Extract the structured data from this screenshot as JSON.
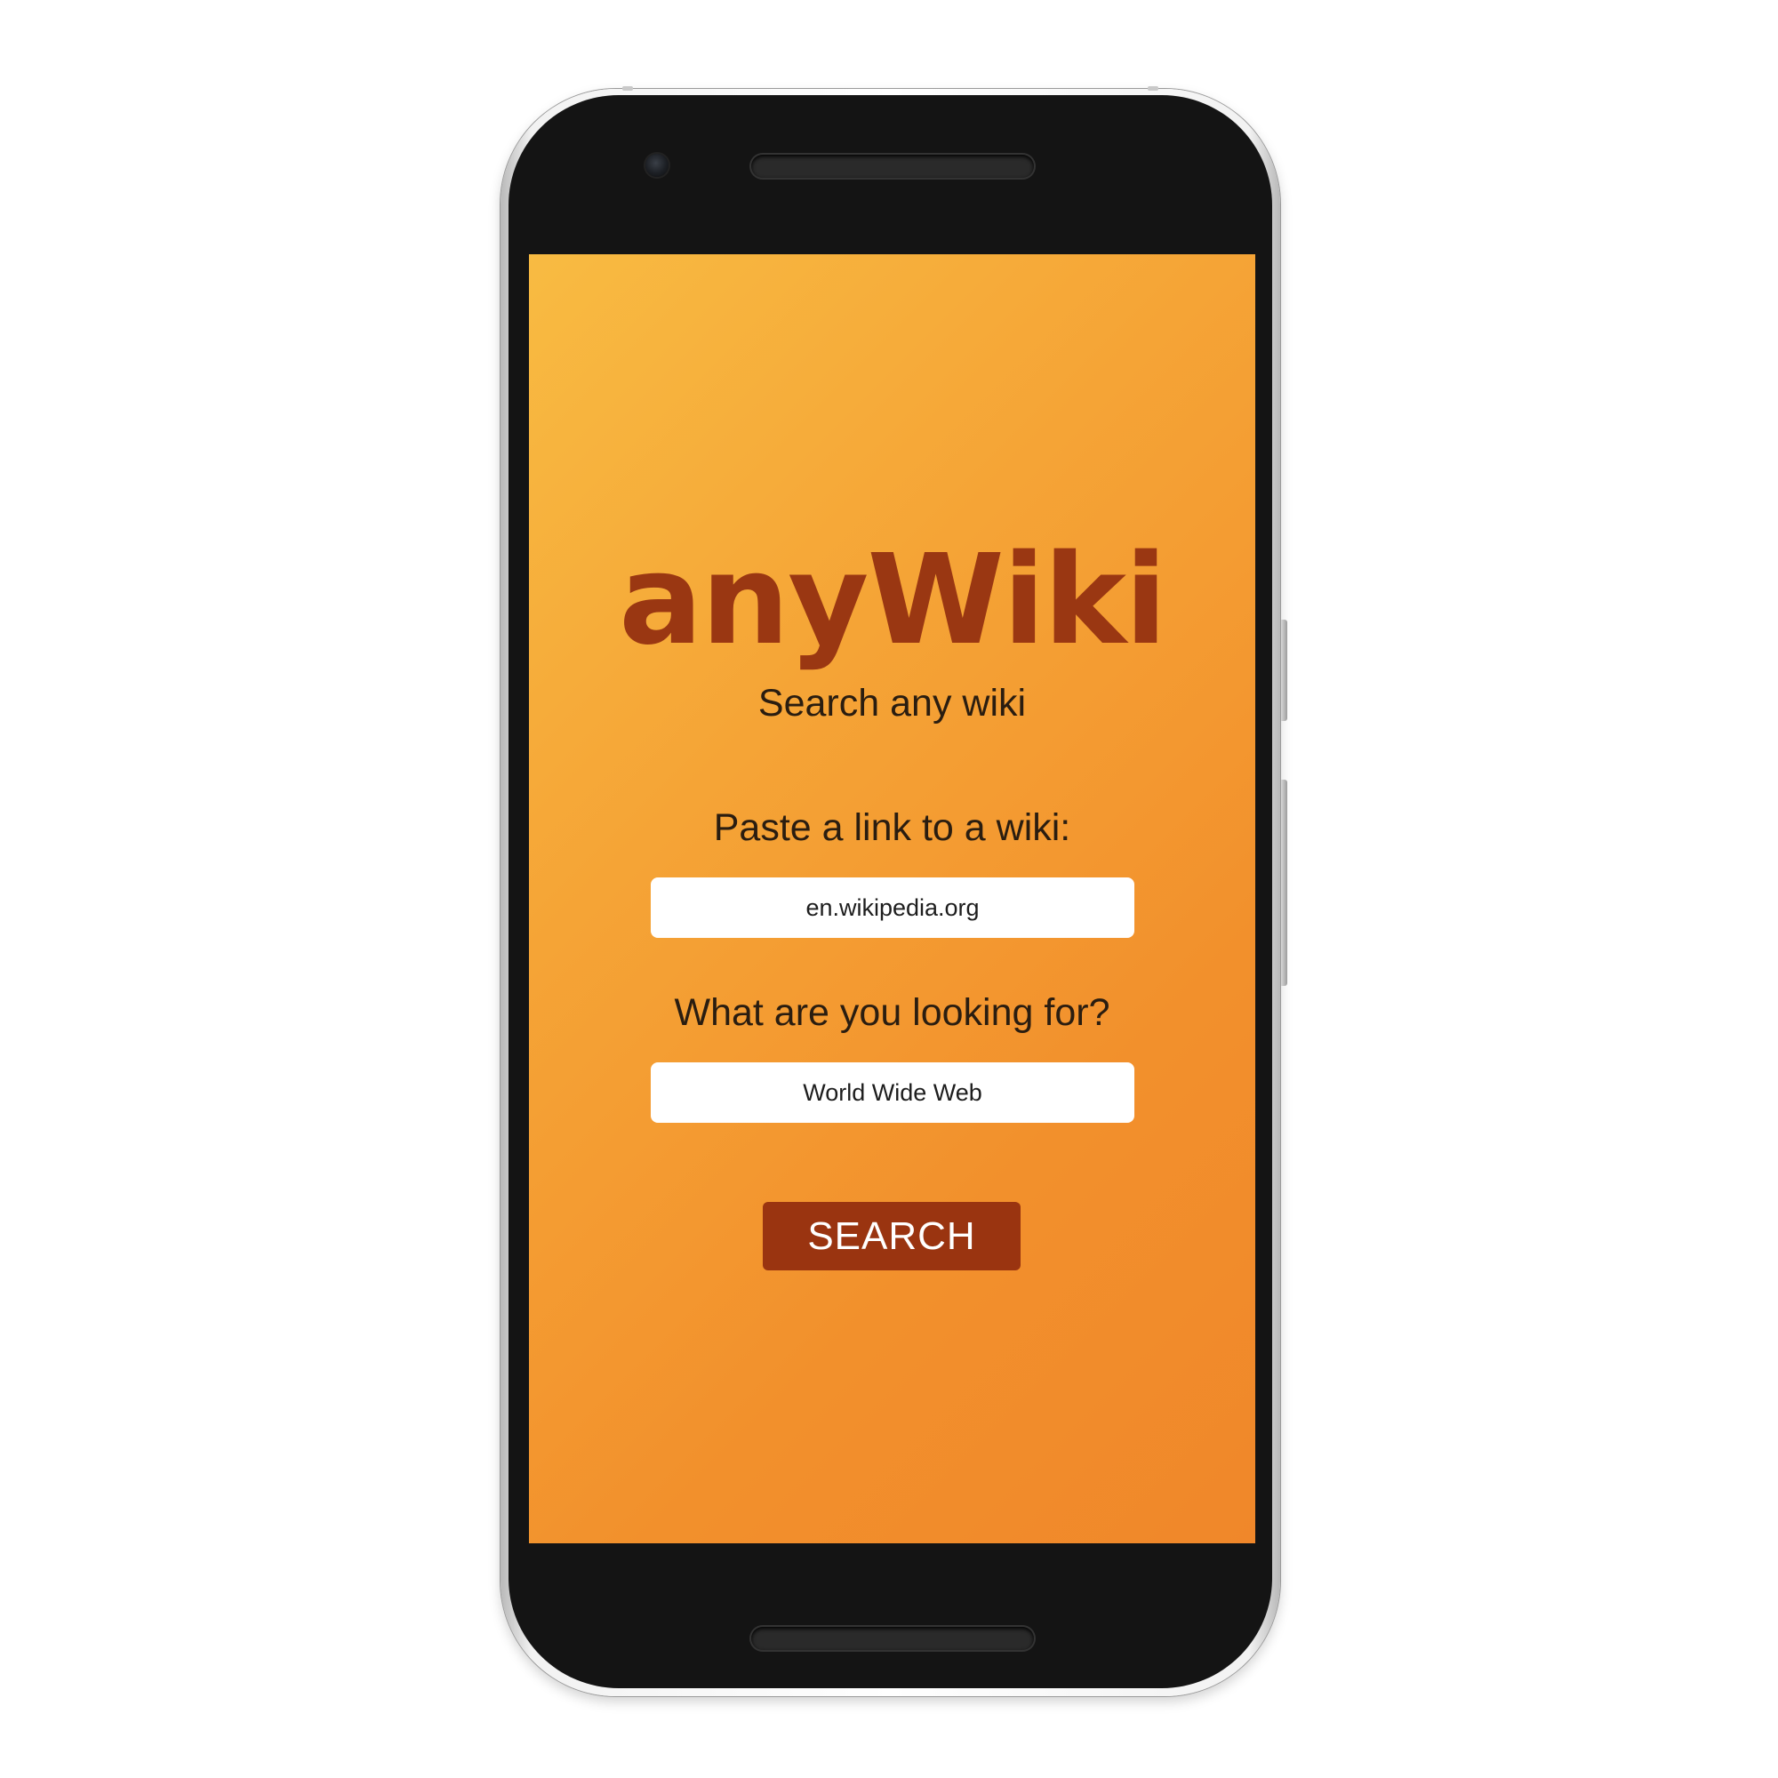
{
  "app": {
    "title": "anyWiki",
    "subtitle": "Search any wiki"
  },
  "form": {
    "wiki_label": "Paste a link to a wiki:",
    "wiki_value": "en.wikipedia.org",
    "query_label": "What are you looking for?",
    "query_value": "World Wide Web",
    "search_button_label": "SEARCH"
  },
  "colors": {
    "background_gradient_start": "#f8bb42",
    "background_gradient_end": "#f0872a",
    "brand_title": "#9a3712",
    "button_background": "#9a3410",
    "button_text": "#ffffff",
    "input_background": "#ffffff",
    "phone_bezel": "#141414"
  },
  "icons": {
    "front_camera": "camera-icon",
    "earpiece": "speaker-grille-icon"
  }
}
